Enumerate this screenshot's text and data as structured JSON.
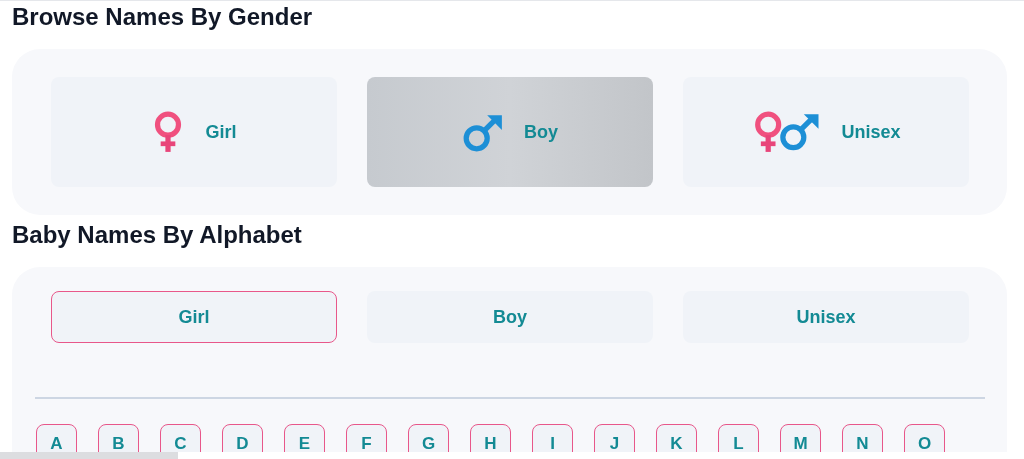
{
  "gender_section": {
    "title": "Browse Names By Gender",
    "cards": [
      {
        "label": "Girl",
        "kind": "girl",
        "selected": false
      },
      {
        "label": "Boy",
        "kind": "boy",
        "selected": true
      },
      {
        "label": "Unisex",
        "kind": "unisex",
        "selected": false
      }
    ]
  },
  "alphabet_section": {
    "title": "Baby Names By Alphabet",
    "tabs": [
      {
        "label": "Girl",
        "selected": true
      },
      {
        "label": "Boy",
        "selected": false
      },
      {
        "label": "Unisex",
        "selected": false
      }
    ],
    "letters": [
      "A",
      "B",
      "C",
      "D",
      "E",
      "F",
      "G",
      "H",
      "I",
      "J",
      "K",
      "L",
      "M",
      "N",
      "O"
    ]
  }
}
